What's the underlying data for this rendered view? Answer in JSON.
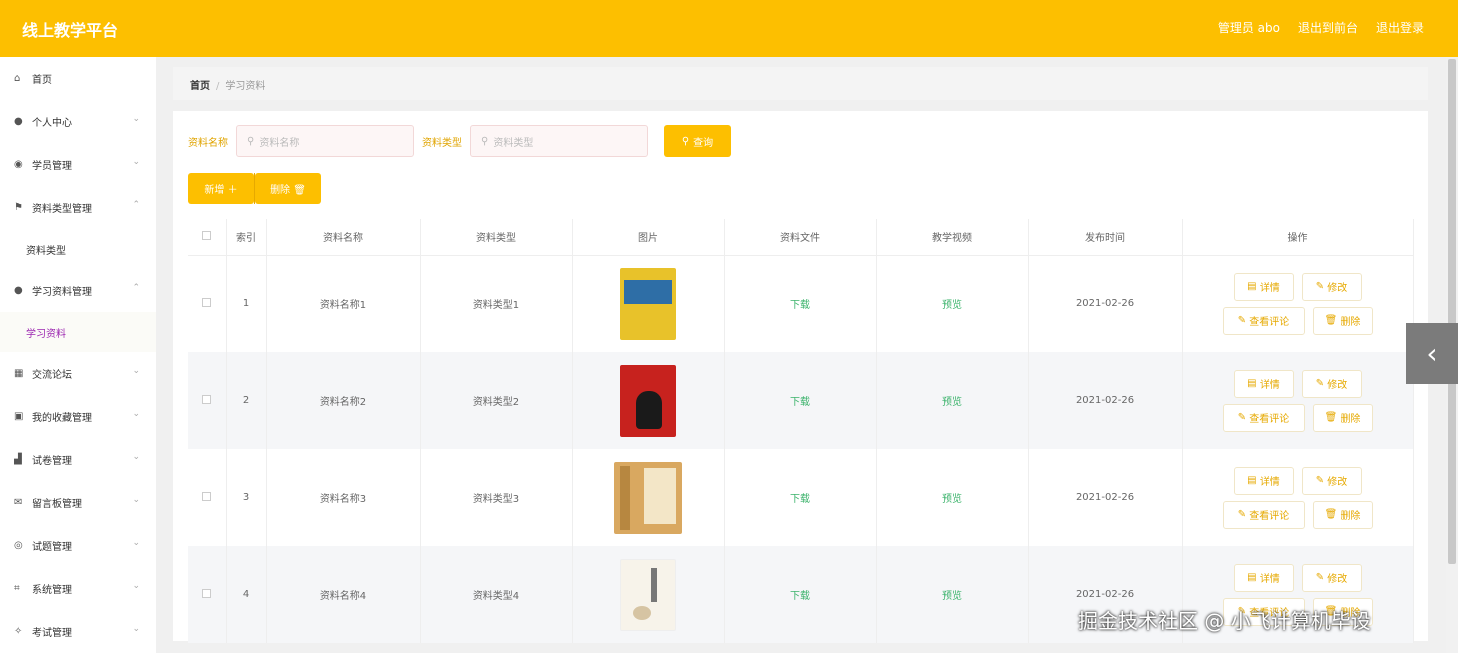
{
  "header": {
    "title": "线上教学平台",
    "user": "管理员 abo",
    "to_front": "退出到前台",
    "logout": "退出登录"
  },
  "sidebar": {
    "items": [
      {
        "label": "首页",
        "icon": "home-icon"
      },
      {
        "label": "个人中心",
        "icon": "user-icon"
      },
      {
        "label": "学员管理",
        "icon": "location-icon"
      },
      {
        "label": "资料类型管理",
        "icon": "flag-icon"
      },
      {
        "label": "资料类型",
        "sub": true
      },
      {
        "label": "学习资料管理",
        "icon": "user-icon"
      },
      {
        "label": "学习资料",
        "sub": true,
        "active": true
      },
      {
        "label": "交流论坛",
        "icon": "grid-icon"
      },
      {
        "label": "我的收藏管理",
        "icon": "picture-icon"
      },
      {
        "label": "试卷管理",
        "icon": "chart-icon"
      },
      {
        "label": "留言板管理",
        "icon": "mail-icon"
      },
      {
        "label": "试题管理",
        "icon": "globe-icon"
      },
      {
        "label": "系统管理",
        "icon": "crop-icon"
      },
      {
        "label": "考试管理",
        "icon": "compass-icon"
      }
    ]
  },
  "breadcrumb": {
    "home": "首页",
    "current": "学习资料"
  },
  "search": {
    "name_label": "资料名称",
    "name_placeholder": "资料名称",
    "type_label": "资料类型",
    "type_placeholder": "资料类型",
    "query": "查询"
  },
  "actions": {
    "add": "新增 ＋",
    "delete": "删除 🗑"
  },
  "table": {
    "headers": [
      "",
      "索引",
      "资料名称",
      "资料类型",
      "图片",
      "资料文件",
      "教学视频",
      "发布时间",
      "操作"
    ],
    "rows": [
      {
        "index": "1",
        "name": "资料名称1",
        "type": "资料类型1",
        "file": "下载",
        "video": "预览",
        "date": "2021-02-26"
      },
      {
        "index": "2",
        "name": "资料名称2",
        "type": "资料类型2",
        "file": "下载",
        "video": "预览",
        "date": "2021-02-26"
      },
      {
        "index": "3",
        "name": "资料名称3",
        "type": "资料类型3",
        "file": "下载",
        "video": "预览",
        "date": "2021-02-26"
      },
      {
        "index": "4",
        "name": "资料名称4",
        "type": "资料类型4",
        "file": "下载",
        "video": "预览",
        "date": "2021-02-26"
      }
    ],
    "ops": {
      "detail": "详情",
      "edit": "修改",
      "comments": "查看评论",
      "delete": "删除"
    }
  },
  "watermark": "掘金技术社区 @ 小飞计算机毕设",
  "colors": {
    "accent": "#fdbf00",
    "active": "#9c27b0",
    "link": "#3bb36b"
  }
}
